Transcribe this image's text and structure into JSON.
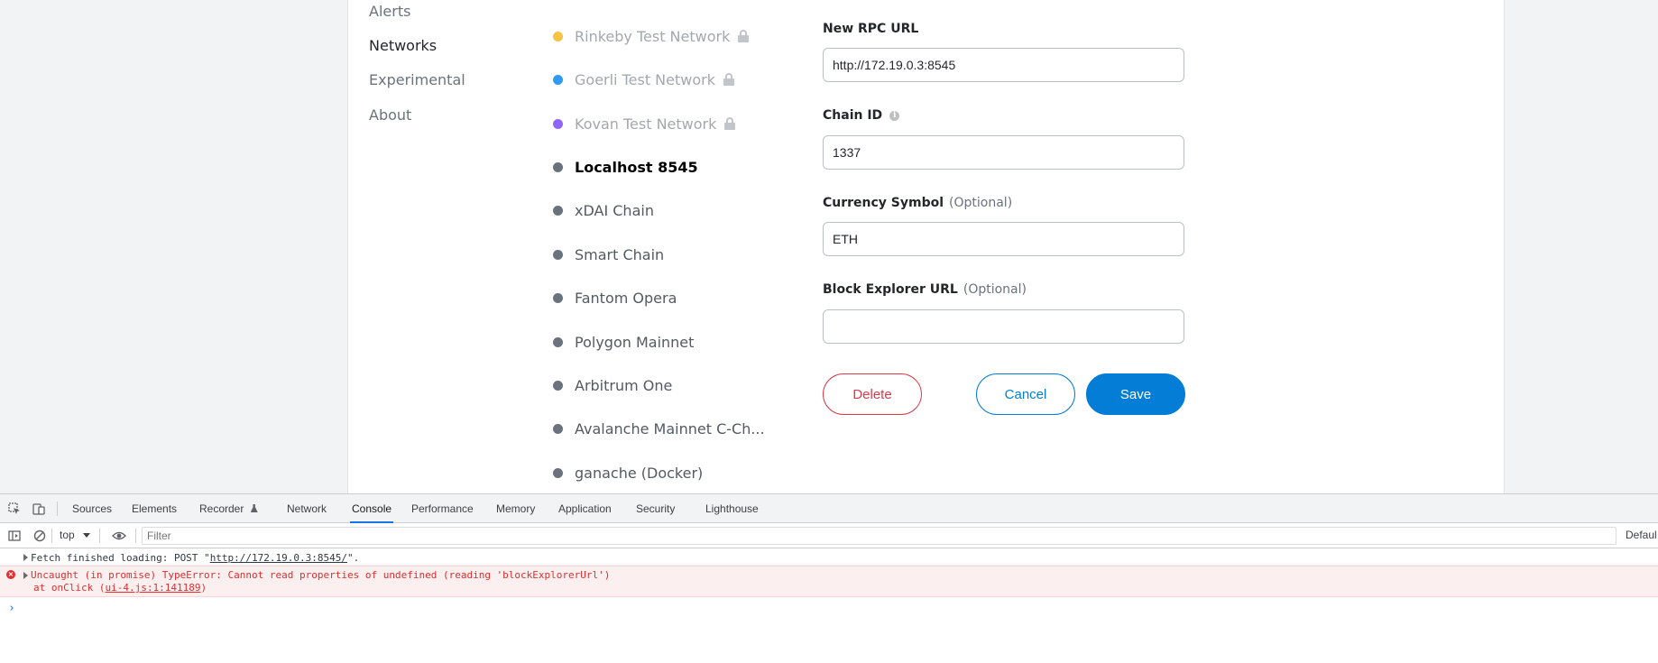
{
  "settings_menu": {
    "items": [
      {
        "label": "Alerts",
        "active": false
      },
      {
        "label": "Networks",
        "active": true
      },
      {
        "label": "Experimental",
        "active": false
      },
      {
        "label": "About",
        "active": false
      }
    ]
  },
  "networks": {
    "items": [
      {
        "label": "Rinkeby Test Network",
        "dot_color": "#f6c343",
        "locked": true
      },
      {
        "label": "Goerli Test Network",
        "dot_color": "#3099f2",
        "locked": true
      },
      {
        "label": "Kovan Test Network",
        "dot_color": "#9064ff",
        "locked": true
      },
      {
        "label": "Localhost 8545",
        "dot_color": "#6a737d",
        "locked": false,
        "selected": true
      },
      {
        "label": "xDAI Chain",
        "dot_color": "#6a737d",
        "locked": false
      },
      {
        "label": "Smart Chain",
        "dot_color": "#6a737d",
        "locked": false
      },
      {
        "label": "Fantom Opera",
        "dot_color": "#6a737d",
        "locked": false
      },
      {
        "label": "Polygon Mainnet",
        "dot_color": "#6a737d",
        "locked": false
      },
      {
        "label": "Arbitrum One",
        "dot_color": "#6a737d",
        "locked": false
      },
      {
        "label": "Avalanche Mainnet C-Ch...",
        "dot_color": "#6a737d",
        "locked": false
      },
      {
        "label": "ganache (Docker)",
        "dot_color": "#6a737d",
        "locked": false
      }
    ]
  },
  "form": {
    "rpc_url": {
      "label": "New RPC URL",
      "value": "http://172.19.0.3:8545"
    },
    "chain_id": {
      "label": "Chain ID",
      "value": "1337"
    },
    "currency_symbol": {
      "label": "Currency Symbol",
      "optional": "(Optional)",
      "value": "ETH"
    },
    "block_explorer": {
      "label": "Block Explorer URL",
      "optional": "(Optional)",
      "value": ""
    },
    "delete_label": "Delete",
    "cancel_label": "Cancel",
    "save_label": "Save"
  },
  "devtools": {
    "tabs": [
      "Sources",
      "Elements",
      "Recorder",
      "Network",
      "Console",
      "Performance",
      "Memory",
      "Application",
      "Security",
      "Lighthouse"
    ],
    "active_tab": "Console",
    "context": "top",
    "filter_placeholder": "Filter",
    "levels_label": "Defaul",
    "console": {
      "log_prefix": "Fetch finished loading: POST \"",
      "log_url": "http://172.19.0.3:8545/",
      "log_suffix": "\".",
      "error_message": "Uncaught (in promise) TypeError: Cannot read properties of undefined (reading 'blockExplorerUrl')",
      "error_stack_prefix": "at onClick (",
      "error_stack_link": "ui-4.js:1:141189",
      "error_stack_suffix": ")",
      "prompt": "›"
    }
  },
  "colors": {
    "accent": "#037dd6",
    "danger": "#d73a49",
    "devtools_error": "#e12e2e"
  }
}
